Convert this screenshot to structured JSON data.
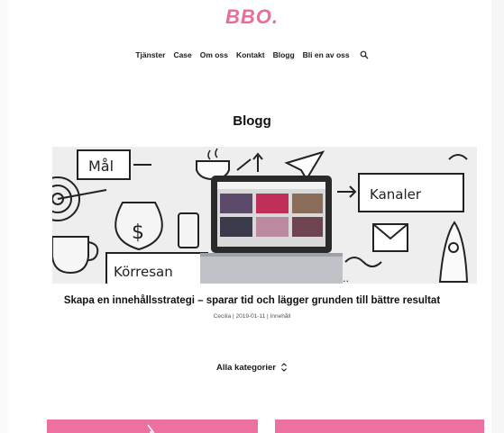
{
  "header": {
    "logo": "BBO."
  },
  "nav": {
    "items": [
      {
        "label": "Tjänster"
      },
      {
        "label": "Case"
      },
      {
        "label": "Om oss"
      },
      {
        "label": "Kontakt"
      },
      {
        "label": "Blogg"
      },
      {
        "label": "Bli en av oss"
      }
    ],
    "search_icon": "search-icon"
  },
  "main": {
    "title": "Blogg",
    "featured_post": {
      "image_labels": {
        "mal": "Mål",
        "kanaler": "Kanaler",
        "korresan": "Körresan"
      },
      "title": "Skapa en innehållsstrategi – sparar tid och lägger grunden till bättre resultat",
      "meta": "Cecilia | 2019-01-11 | Innehåll"
    },
    "filter": {
      "label": "Alla kategorier",
      "icon": "updown-chevron-icon"
    }
  },
  "colors": {
    "brand": "#ea6c9b",
    "card": "#ec71a0"
  }
}
